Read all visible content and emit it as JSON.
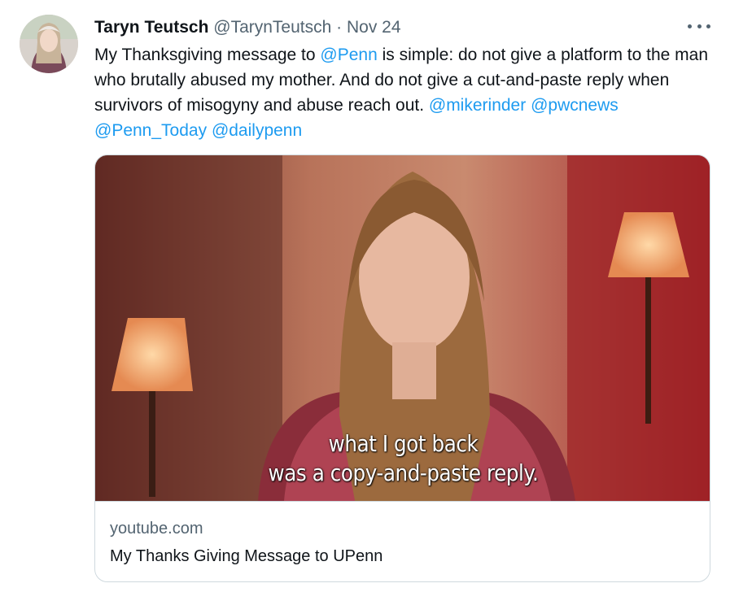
{
  "tweet": {
    "author_name": "Taryn Teutsch",
    "handle": "@TarynTeutsch",
    "separator": "·",
    "date": "Nov 24",
    "more_icon": "more-horizontal-icon",
    "text_parts": {
      "p1": "My Thanksgiving message to ",
      "m1": "@Penn",
      "p2": " is simple: do not give a platform to the man who brutally abused my mother. And do not give a cut-and-paste reply when survivors of misogyny and abuse reach out. ",
      "m2": "@mikerinder",
      "m3": "@pwcnews",
      "m4": "@Penn_Today",
      "m5": "@dailypenn"
    },
    "card": {
      "caption_line1": "what I got back",
      "caption_line2": "was a copy-and-paste reply.",
      "domain": "youtube.com",
      "title": "My Thanks Giving Message to UPenn"
    }
  },
  "colors": {
    "link": "#1d9bf0",
    "secondary_text": "#536471",
    "primary_text": "#0f1419",
    "border": "#cfd9de"
  }
}
